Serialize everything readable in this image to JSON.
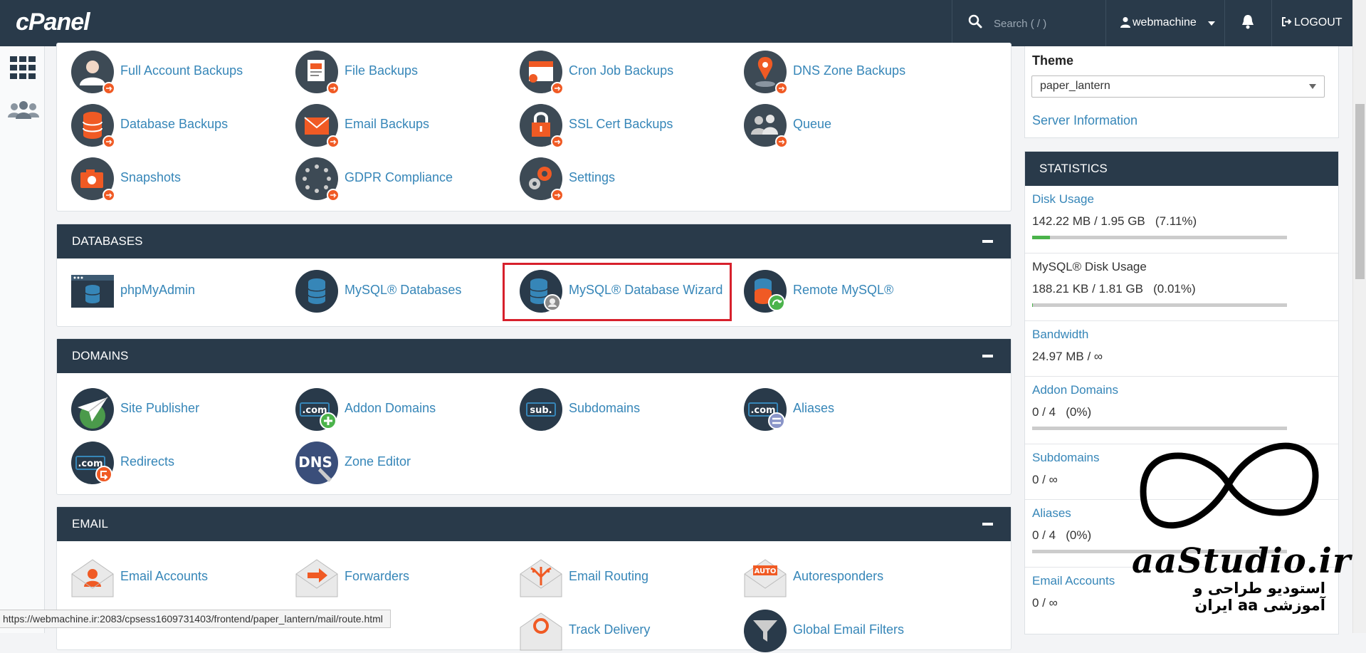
{
  "topbar": {
    "logo": "cPanel",
    "search_placeholder": "Search ( / )",
    "username": "webmachine",
    "logout": "LOGOUT"
  },
  "backups": {
    "items": [
      {
        "label": "Full Account Backups",
        "icon": "full-account-backups-icon"
      },
      {
        "label": "File Backups",
        "icon": "file-backups-icon"
      },
      {
        "label": "Cron Job Backups",
        "icon": "cron-job-backups-icon"
      },
      {
        "label": "DNS Zone Backups",
        "icon": "dns-zone-backups-icon"
      },
      {
        "label": "Database Backups",
        "icon": "database-backups-icon"
      },
      {
        "label": "Email Backups",
        "icon": "email-backups-icon"
      },
      {
        "label": "SSL Cert Backups",
        "icon": "ssl-cert-backups-icon"
      },
      {
        "label": "Queue",
        "icon": "queue-icon"
      },
      {
        "label": "Snapshots",
        "icon": "snapshots-icon"
      },
      {
        "label": "GDPR Compliance",
        "icon": "gdpr-compliance-icon"
      },
      {
        "label": "Settings",
        "icon": "settings-icon"
      }
    ]
  },
  "databases": {
    "title": "DATABASES",
    "items": [
      {
        "label": "phpMyAdmin",
        "icon": "phpmyadmin-icon"
      },
      {
        "label": "MySQL® Databases",
        "icon": "mysql-databases-icon"
      },
      {
        "label": "MySQL® Database Wizard",
        "icon": "mysql-database-wizard-icon"
      },
      {
        "label": "Remote MySQL®",
        "icon": "remote-mysql-icon"
      }
    ]
  },
  "domains": {
    "title": "DOMAINS",
    "items": [
      {
        "label": "Site Publisher",
        "icon": "site-publisher-icon"
      },
      {
        "label": "Addon Domains",
        "icon": "addon-domains-icon"
      },
      {
        "label": "Subdomains",
        "icon": "subdomains-icon"
      },
      {
        "label": "Aliases",
        "icon": "aliases-icon"
      },
      {
        "label": "Redirects",
        "icon": "redirects-icon"
      },
      {
        "label": "Zone Editor",
        "icon": "zone-editor-icon"
      }
    ]
  },
  "email": {
    "title": "EMAIL",
    "items": [
      {
        "label": "Email Accounts",
        "icon": "email-accounts-icon"
      },
      {
        "label": "Forwarders",
        "icon": "forwarders-icon"
      },
      {
        "label": "Email Routing",
        "icon": "email-routing-icon"
      },
      {
        "label": "Autoresponders",
        "icon": "autoresponders-icon"
      },
      {
        "label": "Track Delivery",
        "icon": "track-delivery-icon"
      },
      {
        "label": "Global Email Filters",
        "icon": "global-email-filters-icon"
      }
    ]
  },
  "theme": {
    "label": "Theme",
    "selected": "paper_lantern",
    "server_info": "Server Information"
  },
  "statistics": {
    "title": "STATISTICS",
    "items": [
      {
        "name": "Disk Usage",
        "value": "142.22 MB / 1.95 GB   (7.11%)",
        "fraction": 0.0711
      },
      {
        "name": "MySQL® Disk Usage",
        "value": "188.21 KB / 1.81 GB   (0.01%)",
        "fraction": 0.0001
      },
      {
        "name": "Bandwidth",
        "value": "24.97 MB / ∞"
      },
      {
        "name": "Addon Domains",
        "value": "0 / 4   (0%)",
        "fraction": 0
      },
      {
        "name": "Subdomains",
        "value": "0 / ∞"
      },
      {
        "name": "Aliases",
        "value": "0 / 4   (0%)",
        "fraction": 0
      },
      {
        "name": "Email Accounts",
        "value": "0 / ∞"
      }
    ]
  },
  "status_url": "https://webmachine.ir:2083/cpsess1609731403/frontend/paper_lantern/mail/route.html",
  "watermark": {
    "brand": "aaStudio.ir",
    "subtitle": "استودیو طراحی و آموزشی aa ایران"
  },
  "colors": {
    "header_bg": "#293a4a",
    "link": "#3686b8",
    "highlight": "#d7202c",
    "icon_orange": "#f05a24",
    "usage_bar": "#4bb34b"
  }
}
